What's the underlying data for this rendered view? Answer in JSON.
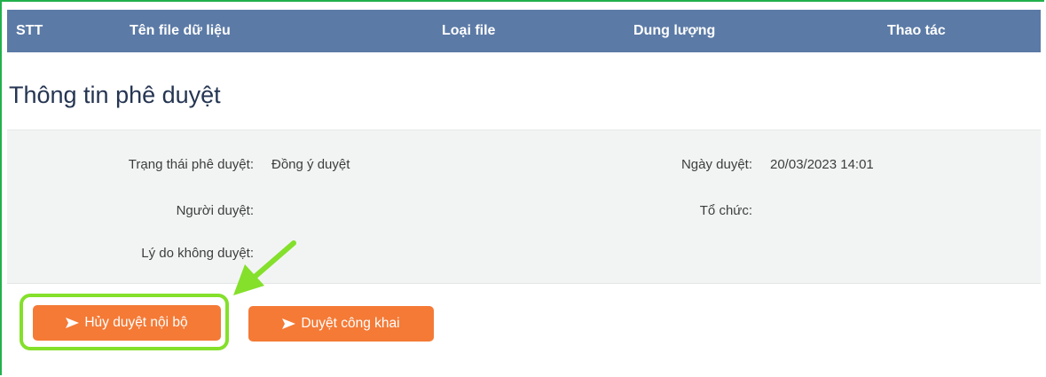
{
  "table_header": {
    "col_stt": "STT",
    "col_file_name": "Tên file dữ liệu",
    "col_file_type": "Loại file",
    "col_size": "Dung lượng",
    "col_actions": "Thao tác"
  },
  "approval_section": {
    "title": "Thông tin phê duyệt",
    "fields": {
      "status_label": "Trạng thái phê duyệt:",
      "status_value": "Đồng ý duyệt",
      "approver_label": "Người duyệt:",
      "approver_value": "",
      "reject_reason_label": "Lý do không duyệt:",
      "reject_reason_value": "",
      "approval_date_label": "Ngày duyệt:",
      "approval_date_value": "20/03/2023 14:01",
      "organization_label": "Tổ chức:",
      "organization_value": ""
    }
  },
  "actions": {
    "cancel_internal_label": "Hủy duyệt nội bộ",
    "publish_label": "Duyệt công khai"
  },
  "icons": {
    "button_icon": "send-arrow-icon",
    "annotation": "green-pointer-arrow"
  },
  "colors": {
    "header_bg": "#5b7aa6",
    "button_bg": "#f47a36",
    "highlight": "#84e02b",
    "title_text": "#253552"
  }
}
